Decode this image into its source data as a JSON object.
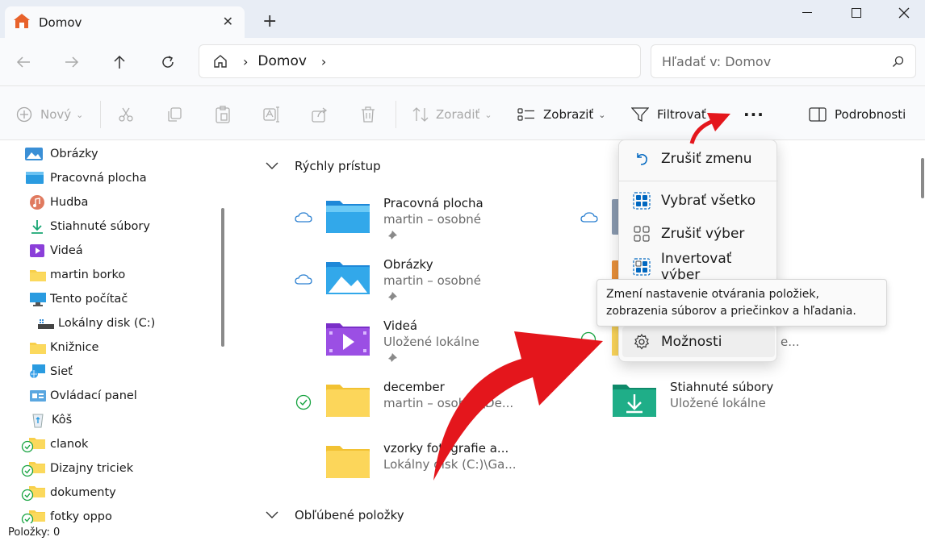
{
  "window": {
    "tab_title": "Domov",
    "tab_close_icon": "close-icon",
    "new_tab_icon": "plus-icon"
  },
  "nav": {
    "address_segment": "Domov",
    "search_placeholder": "Hľadať v: Domov"
  },
  "toolbar": {
    "new_label": "Nový",
    "sort_label": "Zoradiť",
    "view_label": "Zobraziť",
    "filter_label": "Filtrovať",
    "more_label": "···",
    "details_label": "Podrobnosti"
  },
  "sidebar": {
    "items": [
      {
        "label": "Obrázky",
        "icon": "pictures-icon"
      },
      {
        "label": "Pracovná plocha",
        "icon": "desktop-icon"
      },
      {
        "label": "Hudba",
        "icon": "music-icon"
      },
      {
        "label": "Stiahnuté súbory",
        "icon": "download-icon"
      },
      {
        "label": "Videá",
        "icon": "video-icon"
      },
      {
        "label": "martin borko",
        "icon": "folder-icon"
      },
      {
        "label": "Tento počítač",
        "icon": "computer-icon"
      },
      {
        "label": "Lokálny disk (C:)",
        "icon": "drive-icon"
      },
      {
        "label": "Knižnice",
        "icon": "folder-icon"
      },
      {
        "label": "Sieť",
        "icon": "network-icon"
      },
      {
        "label": "Ovládací panel",
        "icon": "control-panel-icon"
      },
      {
        "label": "Kôš",
        "icon": "recycle-bin-icon"
      },
      {
        "label": "clanok",
        "icon": "folder-icon"
      },
      {
        "label": "Dizajny triciek",
        "icon": "folder-icon"
      },
      {
        "label": "dokumenty",
        "icon": "folder-icon"
      },
      {
        "label": "fotky oppo",
        "icon": "folder-icon"
      }
    ]
  },
  "main": {
    "quick_access_title": "Rýchly prístup",
    "favorites_title": "Obľúbené položky",
    "quick_items": [
      {
        "name": "Pracovná plocha",
        "sub": "martin – osobné",
        "status": "cloud"
      },
      {
        "name": "Obrázky",
        "sub": "martin – osobné",
        "status": "cloud"
      },
      {
        "name": "Videá",
        "sub": "Uložené lokálne",
        "status": ""
      },
      {
        "name": "december",
        "sub": "martin – osobné\\De...",
        "status": "synced"
      },
      {
        "name": "vzorky fotografie a...",
        "sub": "Lokálny disk (C:)\\Ga...",
        "status": ""
      },
      {
        "name": "Stiahnuté súbory",
        "sub": "Uložené lokálne",
        "status": ""
      }
    ],
    "partial_text": "e..."
  },
  "menu": {
    "undo_label": "Zrušiť zmenu",
    "select_all_label": "Vybrať všetko",
    "select_none_label": "Zrušiť výber",
    "invert_label": "Invertovať výber",
    "options_label": "Možnosti"
  },
  "tooltip": {
    "text": "Zmení nastavenie otvárania položiek, zobrazenia súborov a priečinkov a hľadania."
  },
  "status": {
    "items_count": "Položky: 0"
  },
  "colors": {
    "accent": "#0067c0",
    "folder_yellow": "#f8cf4a",
    "arrow_red": "#e4161c"
  }
}
